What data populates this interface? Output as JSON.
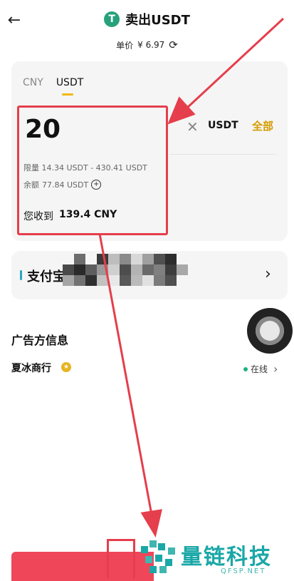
{
  "header": {
    "title": "卖出USDT",
    "price_label": "单价",
    "price_value": "¥ 6.97"
  },
  "tabs": [
    {
      "label": "CNY",
      "active": false
    },
    {
      "label": "USDT",
      "active": true
    }
  ],
  "amount": {
    "value": "20",
    "limit_label": "限量",
    "limit_text": "14.34 USDT - 430.41 USDT",
    "balance_label": "余额",
    "balance_text": "77.84 USDT",
    "receive_label": "您收到",
    "receive_value": "139.4 CNY",
    "currency": "USDT",
    "all_label": "全部"
  },
  "payment": {
    "label": "支付宝"
  },
  "advertiser": {
    "section_title": "广告方信息",
    "merchant_name": "夏冰商行",
    "status": "在线"
  },
  "watermark": {
    "title": "量链科技",
    "subtitle": "QFSP.NET"
  },
  "colors": {
    "accent": "#f0b90b",
    "tether": "#26a17b",
    "annotation": "#e53e4c",
    "online": "#1db37a",
    "sell": "#f0465a",
    "watermark": "#1aa7a7"
  },
  "icons": {
    "back": "back-arrow-icon",
    "tether": "tether-icon",
    "refresh": "refresh-icon",
    "clear": "close-icon",
    "chevron": "chevron-right-icon"
  }
}
